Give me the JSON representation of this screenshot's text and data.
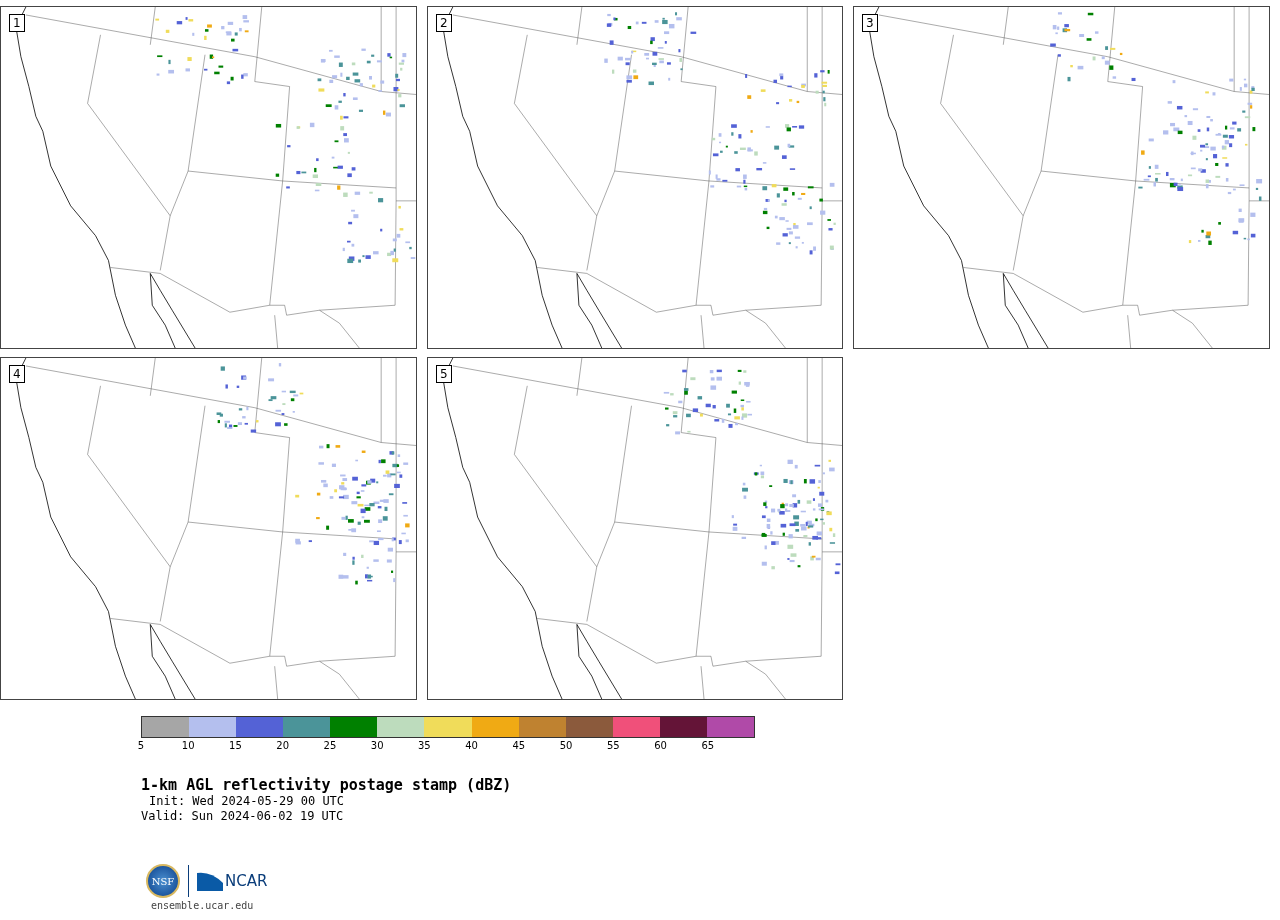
{
  "panels": [
    {
      "label": "1"
    },
    {
      "label": "2"
    },
    {
      "label": "3"
    },
    {
      "label": "4"
    },
    {
      "label": "5"
    }
  ],
  "colorbar": {
    "bins": [
      {
        "color": "#a6a6a6"
      },
      {
        "color": "#b4bfee"
      },
      {
        "color": "#5462d6"
      },
      {
        "color": "#4b9499"
      },
      {
        "color": "#008000"
      },
      {
        "color": "#bddcbd"
      },
      {
        "color": "#f0dc5a"
      },
      {
        "color": "#f0aa14"
      },
      {
        "color": "#bf8230"
      },
      {
        "color": "#8b5a3c"
      },
      {
        "color": "#f0507a"
      },
      {
        "color": "#641437"
      },
      {
        "color": "#b04aa8"
      }
    ],
    "ticks": [
      "5",
      "10",
      "15",
      "20",
      "25",
      "30",
      "35",
      "40",
      "45",
      "50",
      "55",
      "60",
      "65"
    ]
  },
  "title": "1-km AGL reflectivity postage stamp (dBZ)",
  "init": "Init: Wed 2024-05-29 00 UTC",
  "valid": "Valid: Sun 2024-06-02 19 UTC",
  "logo": {
    "left": "NSF",
    "right": "NCAR"
  },
  "url": "ensemble.ucar.edu"
}
